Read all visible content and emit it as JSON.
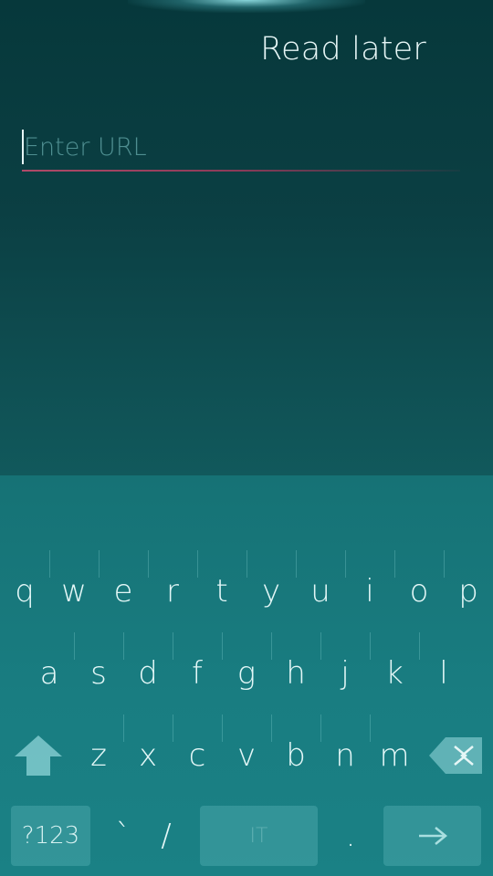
{
  "header": {
    "title": "Read later"
  },
  "url_field": {
    "placeholder": "Enter URL",
    "value": ""
  },
  "keyboard": {
    "row1": [
      "q",
      "w",
      "e",
      "r",
      "t",
      "y",
      "u",
      "i",
      "o",
      "p"
    ],
    "row2": [
      "a",
      "s",
      "d",
      "f",
      "g",
      "h",
      "j",
      "k",
      "l"
    ],
    "row3": [
      "z",
      "x",
      "c",
      "v",
      "b",
      "n",
      "m"
    ],
    "symbols_label": "?123",
    "backtick": "`",
    "slash": "/",
    "space_label": "IT",
    "period": ".",
    "shift_icon": "shift-arrow-up",
    "backspace_icon": "backspace",
    "enter_icon": "arrow-right"
  },
  "colors": {
    "background_top": "#06383b",
    "keyboard": "#167275",
    "text": "#e6f6f6",
    "field_underline": "#b04a68"
  }
}
